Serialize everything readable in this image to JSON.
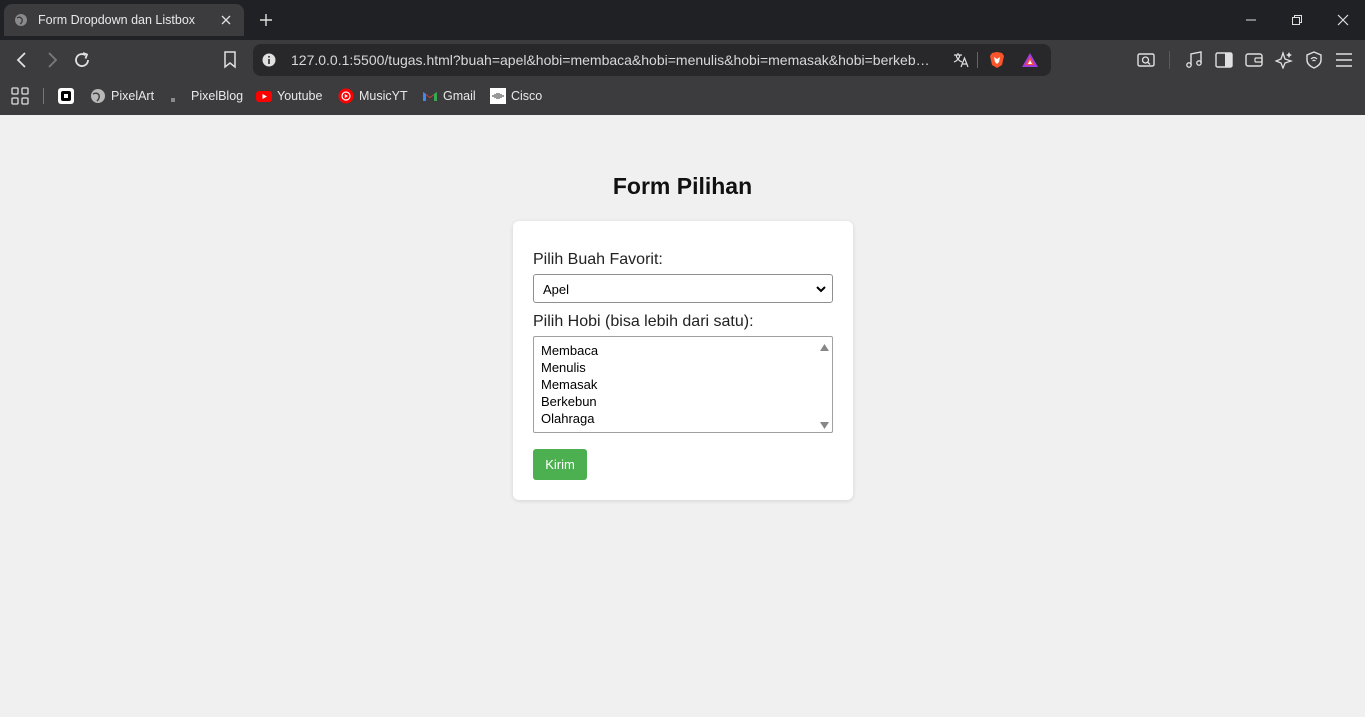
{
  "browser": {
    "tab_title": "Form Dropdown dan Listbox",
    "url": "127.0.0.1:5500/tugas.html?buah=apel&hobi=membaca&hobi=menulis&hobi=memasak&hobi=berkeb…",
    "bookmarks": [
      "PixelArt",
      "PixelBlog",
      "Youtube",
      "MusicYT",
      "Gmail",
      "Cisco"
    ]
  },
  "page": {
    "heading": "Form Pilihan",
    "fruit_label": "Pilih Buah Favorit:",
    "fruit_selected": "Apel",
    "hobby_label": "Pilih Hobi (bisa lebih dari satu):",
    "hobby_options": [
      "Membaca",
      "Menulis",
      "Memasak",
      "Berkebun",
      "Olahraga"
    ],
    "submit_label": "Kirim"
  },
  "colors": {
    "accent": "#4caf50",
    "background": "#f0f0f0"
  }
}
